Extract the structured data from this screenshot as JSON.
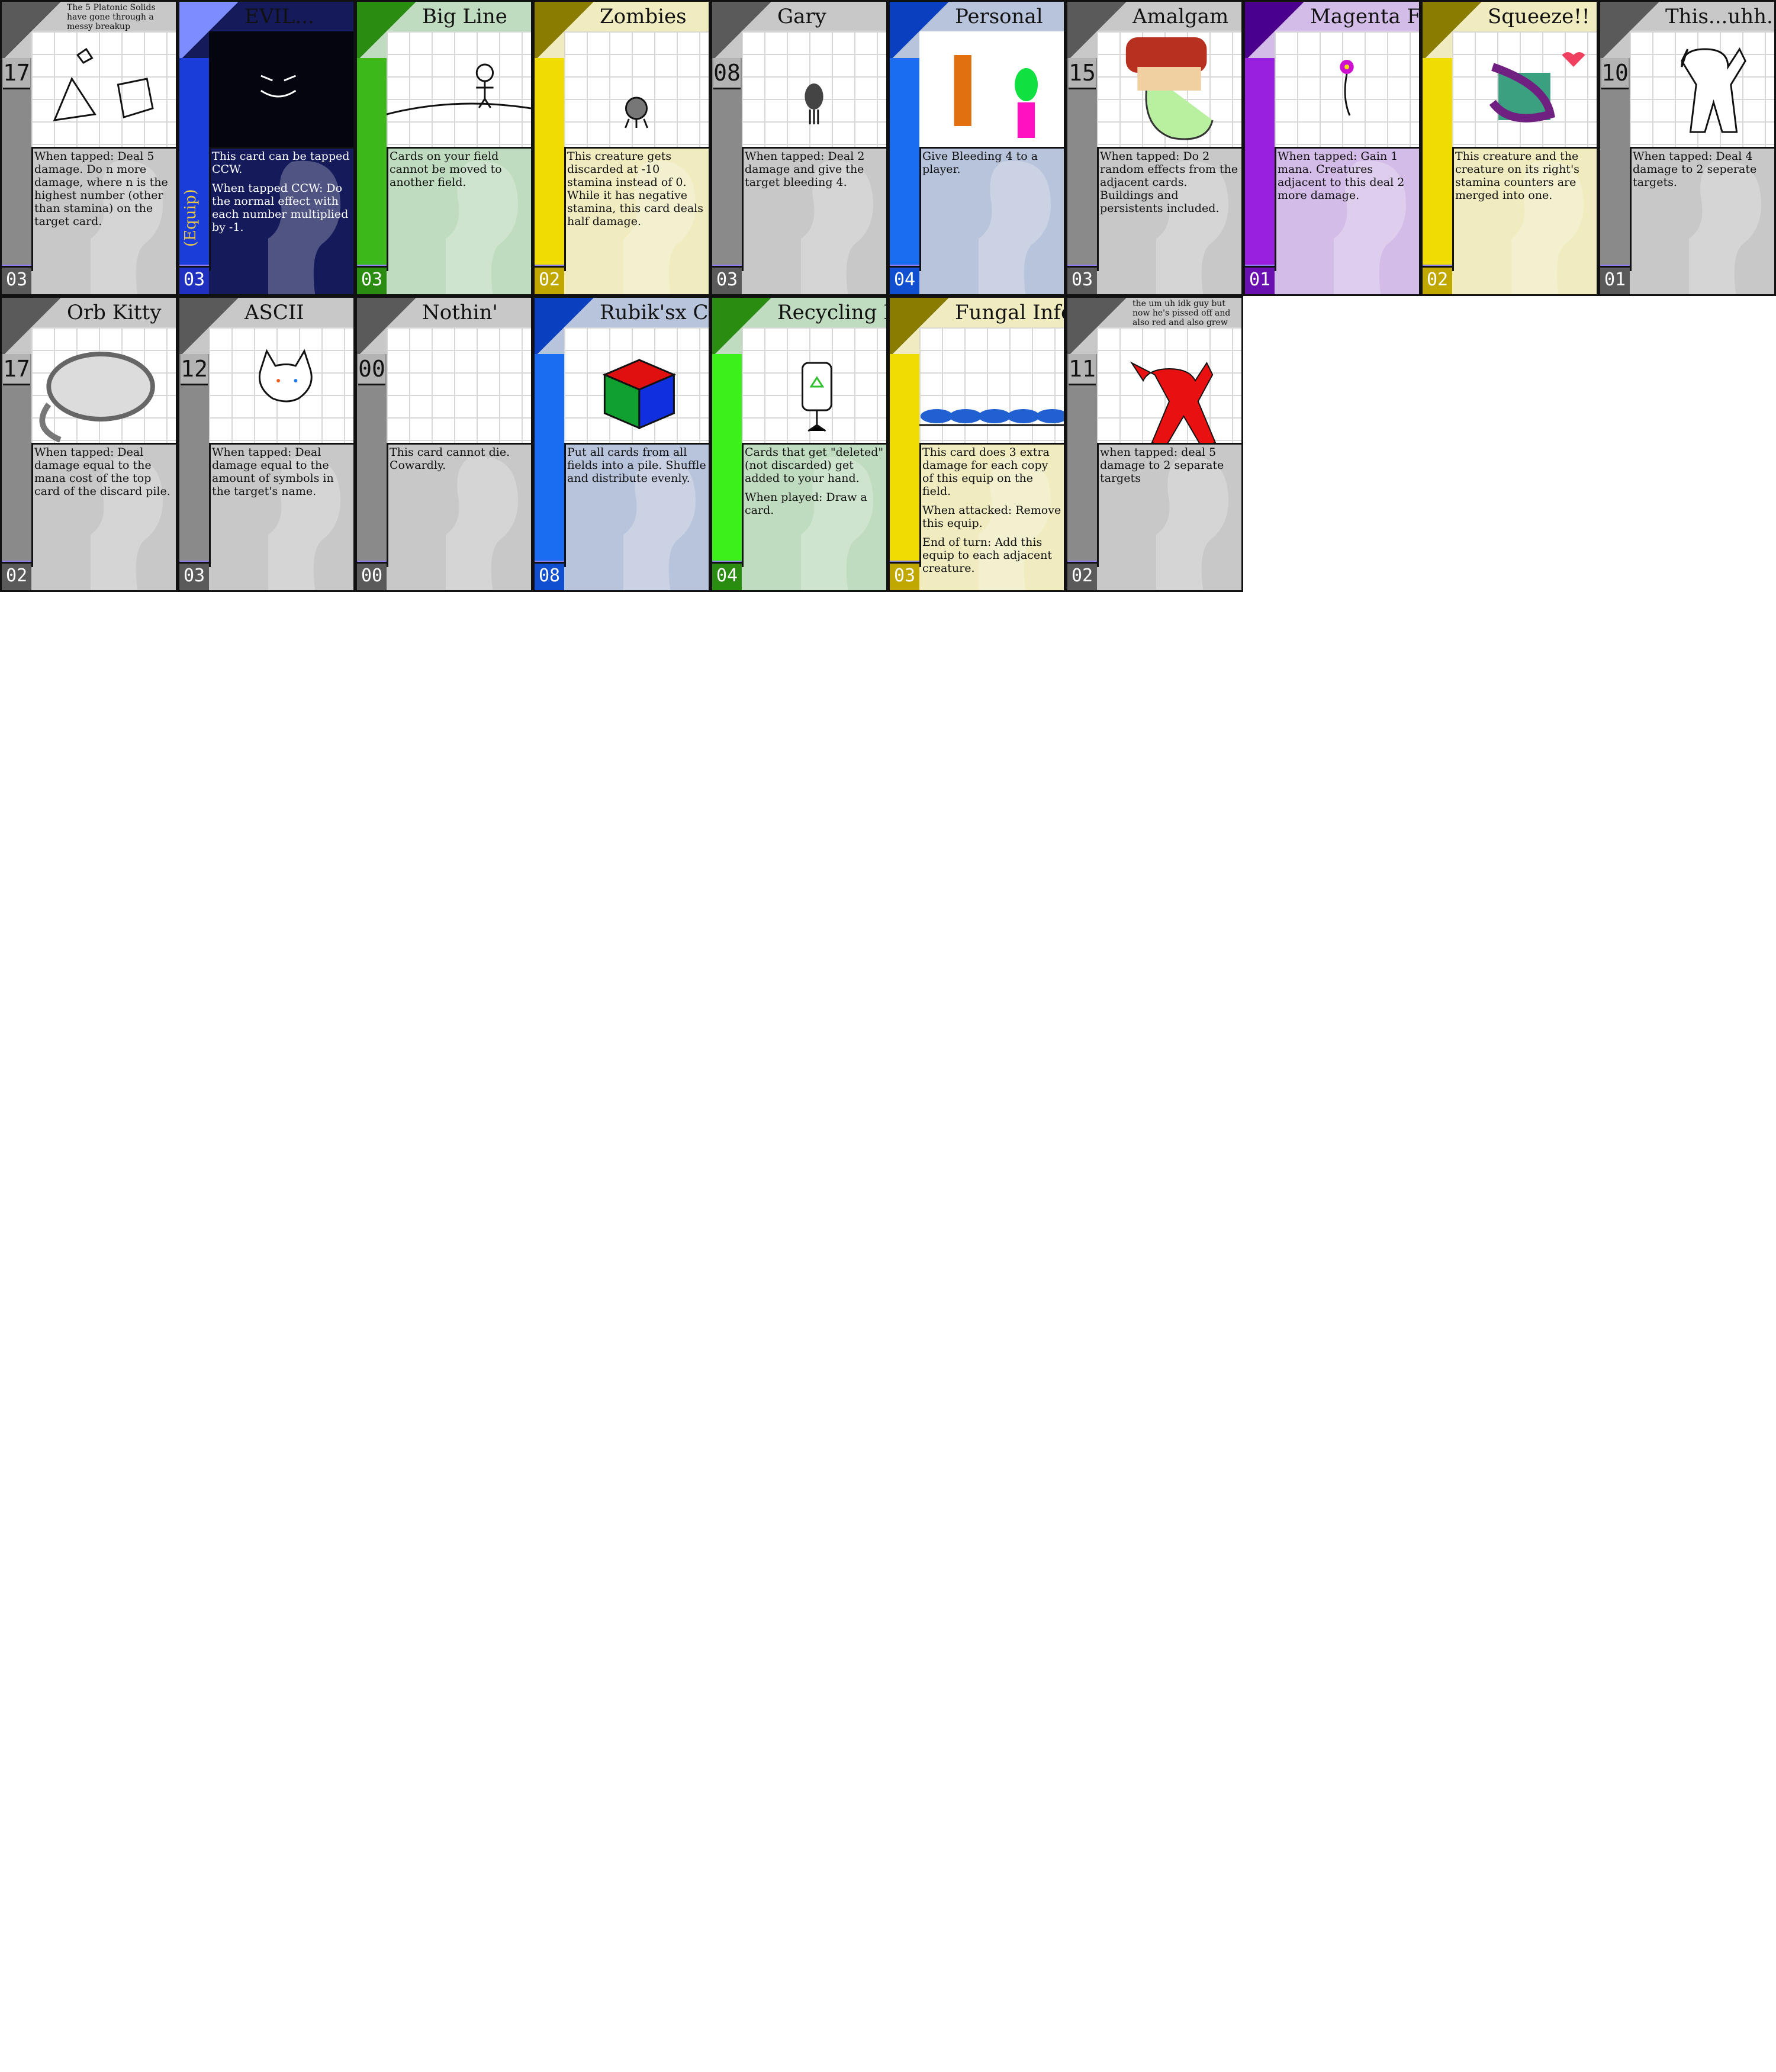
{
  "cards": [
    {
      "id": "platonic",
      "title": "The 5 Platonic Solids have gone through a messy breakup",
      "title_small": true,
      "cost": "17",
      "bottom": "03",
      "text": [
        "When tapped: Deal 5 damage. Do n more damage, where n is the highest number (other than stamina) on the target card."
      ],
      "colors": {
        "tab": "#5a5a5a",
        "stripe": "#8a8a8a",
        "bg": "#c8c8c8",
        "bottom": "#5a5a5a"
      }
    },
    {
      "id": "evil",
      "title": "EVIL...",
      "title_small": false,
      "cost": "",
      "bottom": "03",
      "equip": "(Equip)",
      "text": [
        "This card can be tapped CCW.",
        "When tapped CCW: Do the normal effect with each number multiplied by -1."
      ],
      "colors": {
        "tab": "#7d8cff",
        "stripe": "#1a3cd8",
        "bg": "#141a5a",
        "bottom": "#2030c0"
      }
    },
    {
      "id": "bigline",
      "title": "Big Line",
      "title_small": false,
      "cost": "",
      "bottom": "03",
      "text": [
        "Cards on your field cannot be moved to another field."
      ],
      "colors": {
        "tab": "#2a8c10",
        "stripe": "#3cb81a",
        "bg": "#c0dcc0",
        "bottom": "#2a8c10"
      }
    },
    {
      "id": "zombies",
      "title": "Zombies",
      "title_small": false,
      "cost": "",
      "bottom": "02",
      "text": [
        "This creature gets discarded at -10 stamina instead of 0. While it has negative stamina, this card deals half damage."
      ],
      "colors": {
        "tab": "#8a7c00",
        "stripe": "#f0dc00",
        "bg": "#f0ecc0",
        "bottom": "#c0a800"
      }
    },
    {
      "id": "gary",
      "title": "Gary",
      "title_small": false,
      "cost": "08",
      "bottom": "03",
      "text": [
        "When tapped: Deal 2 damage and give the target bleeding 4."
      ],
      "colors": {
        "tab": "#5a5a5a",
        "stripe": "#8a8a8a",
        "bg": "#c8c8c8",
        "bottom": "#5a5a5a"
      }
    },
    {
      "id": "personal",
      "title": "Personal",
      "title_small": false,
      "cost": "",
      "bottom": "04",
      "text": [
        "Give Bleeding 4 to a player."
      ],
      "colors": {
        "tab": "#0a40c0",
        "stripe": "#1a6cf0",
        "bg": "#b8c4dc",
        "bottom": "#1050d0"
      }
    },
    {
      "id": "amalgam",
      "title": "Amalgam",
      "title_small": false,
      "cost": "15",
      "bottom": "03",
      "text": [
        "When tapped: Do 2 random effects from the adjacent cards. Buildings and persistents included."
      ],
      "colors": {
        "tab": "#5a5a5a",
        "stripe": "#8a8a8a",
        "bg": "#c8c8c8",
        "bottom": "#5a5a5a"
      }
    },
    {
      "id": "magenta",
      "title": "Magenta Flower",
      "title_small": false,
      "cost": "",
      "bottom": "01",
      "text": [
        "When tapped: Gain 1 mana. Creatures adjacent to this deal 2 more damage."
      ],
      "colors": {
        "tab": "#4a008c",
        "stripe": "#9a20e0",
        "bg": "#d4bce8",
        "bottom": "#6a10b0"
      }
    },
    {
      "id": "squeeze",
      "title": "Squeeze!!",
      "title_small": false,
      "cost": "",
      "bottom": "02",
      "text": [
        "This creature and the creature on its right's stamina counters are merged into one."
      ],
      "colors": {
        "tab": "#8a7c00",
        "stripe": "#f0dc00",
        "bg": "#f0ecc0",
        "bottom": "#c0a800"
      }
    },
    {
      "id": "thisuhh",
      "title": "This...uhh... idk",
      "title_small": false,
      "cost": "10",
      "bottom": "01",
      "text": [
        "When tapped: Deal 4 damage to 2 seperate targets."
      ],
      "colors": {
        "tab": "#5a5a5a",
        "stripe": "#8a8a8a",
        "bg": "#c8c8c8",
        "bottom": "#5a5a5a"
      }
    },
    {
      "id": "orbkitty",
      "title": "Orb Kitty",
      "title_small": false,
      "cost": "17",
      "bottom": "02",
      "text": [
        "When tapped: Deal damage equal to the mana cost of the top card of the discard pile."
      ],
      "colors": {
        "tab": "#5a5a5a",
        "stripe": "#8a8a8a",
        "bg": "#c8c8c8",
        "bottom": "#5a5a5a"
      }
    },
    {
      "id": "ascii",
      "title": "ASCII",
      "title_small": false,
      "cost": "12",
      "bottom": "03",
      "text": [
        "When tapped: Deal damage equal to the amount of symbols in the target's name."
      ],
      "colors": {
        "tab": "#5a5a5a",
        "stripe": "#8a8a8a",
        "bg": "#c8c8c8",
        "bottom": "#5a5a5a"
      }
    },
    {
      "id": "nothin",
      "title": "Nothin'",
      "title_small": false,
      "cost": "00",
      "bottom": "00",
      "text": [
        "This card cannot die. Cowardly."
      ],
      "colors": {
        "tab": "#5a5a5a",
        "stripe": "#8a8a8a",
        "bg": "#c8c8c8",
        "bottom": "#5a5a5a"
      }
    },
    {
      "id": "rubiks",
      "title": "Rubik'sx Cubiksx",
      "title_small": false,
      "cost": "",
      "bottom": "08",
      "text": [
        "Put all cards from all fields into a pile. Shuffle and distribute evenly."
      ],
      "colors": {
        "tab": "#0a40c0",
        "stripe": "#1a6cf0",
        "bg": "#b8c4dc",
        "bottom": "#1050d0"
      }
    },
    {
      "id": "recycling",
      "title": "Recycling Bin",
      "title_small": false,
      "cost": "",
      "bottom": "04",
      "text": [
        "Cards that get \"deleted\" (not discarded) get added to your hand.",
        "When played: Draw a card."
      ],
      "colors": {
        "tab": "#2a8c10",
        "stripe": "#3cf01a",
        "bg": "#c0dcc0",
        "bottom": "#2a8c10"
      }
    },
    {
      "id": "fungal",
      "title": "Fungal Infection",
      "title_small": false,
      "cost": "",
      "bottom": "03",
      "text": [
        "This card does 3 extra damage for each copy of this equip on the field.",
        "When attacked: Remove this equip.",
        "End of turn: Add this equip to each adjacent creature."
      ],
      "colors": {
        "tab": "#8a7c00",
        "stripe": "#f0dc00",
        "bg": "#f0ecc0",
        "bottom": "#c0a800"
      }
    },
    {
      "id": "umuh",
      "title": "the um uh idk guy but now he's pissed off and also red and also grew another eye",
      "title_small": true,
      "cost": "11",
      "bottom": "02",
      "text": [
        "when tapped: deal 5 damage to 2 separate targets"
      ],
      "colors": {
        "tab": "#5a5a5a",
        "stripe": "#8a8a8a",
        "bg": "#c8c8c8",
        "bottom": "#5a5a5a"
      }
    }
  ]
}
